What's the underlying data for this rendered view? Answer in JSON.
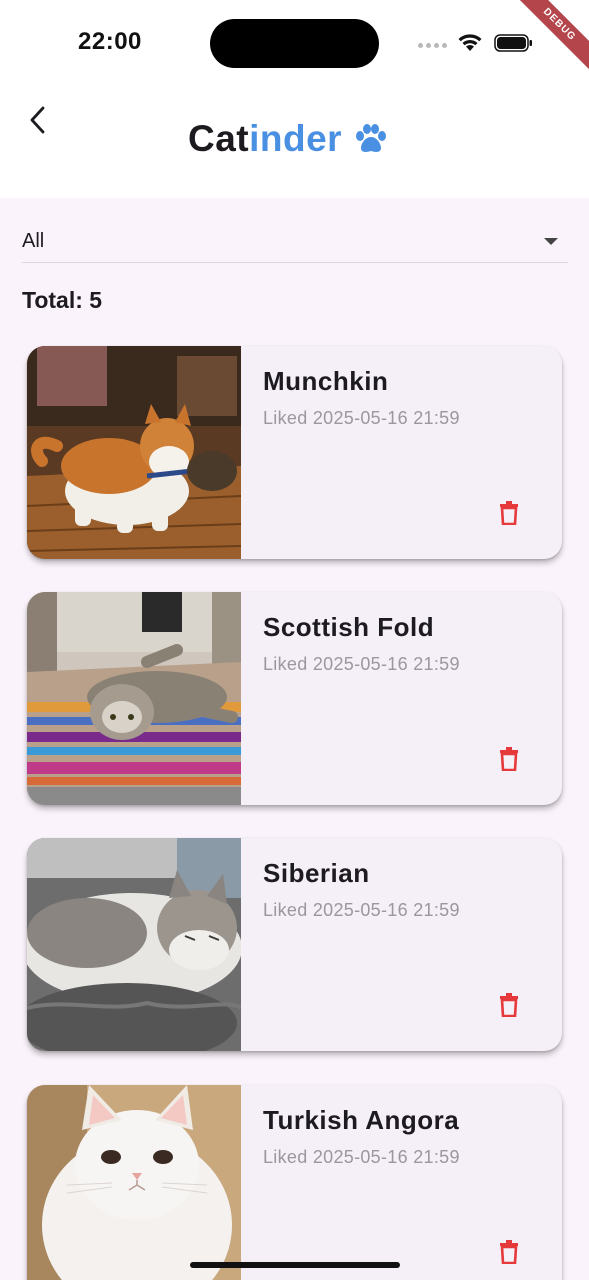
{
  "status_bar": {
    "time": "22:00"
  },
  "debug_banner": "DEBUG",
  "header": {
    "title_part1": "Cat",
    "title_part2": "inder",
    "title_color_primary": "#1d1b20",
    "title_color_accent": "#4a90e2",
    "back_icon": "chevron-left-icon",
    "logo_icon": "paw-icon"
  },
  "filter": {
    "selected": "All"
  },
  "total_label": "Total: 5",
  "cards": [
    {
      "name": "Munchkin",
      "liked": "Liked 2025-05-16 21:59",
      "delete_icon": "trash-icon"
    },
    {
      "name": "Scottish Fold",
      "liked": "Liked 2025-05-16 21:59",
      "delete_icon": "trash-icon"
    },
    {
      "name": "Siberian",
      "liked": "Liked 2025-05-16 21:59",
      "delete_icon": "trash-icon"
    },
    {
      "name": "Turkish Angora",
      "liked": "Liked 2025-05-16 21:59",
      "delete_icon": "trash-icon"
    }
  ],
  "colors": {
    "background": "#fbf3fb",
    "card": "#f5eff7",
    "delete": "#e5393b",
    "accent": "#4a90e2"
  }
}
